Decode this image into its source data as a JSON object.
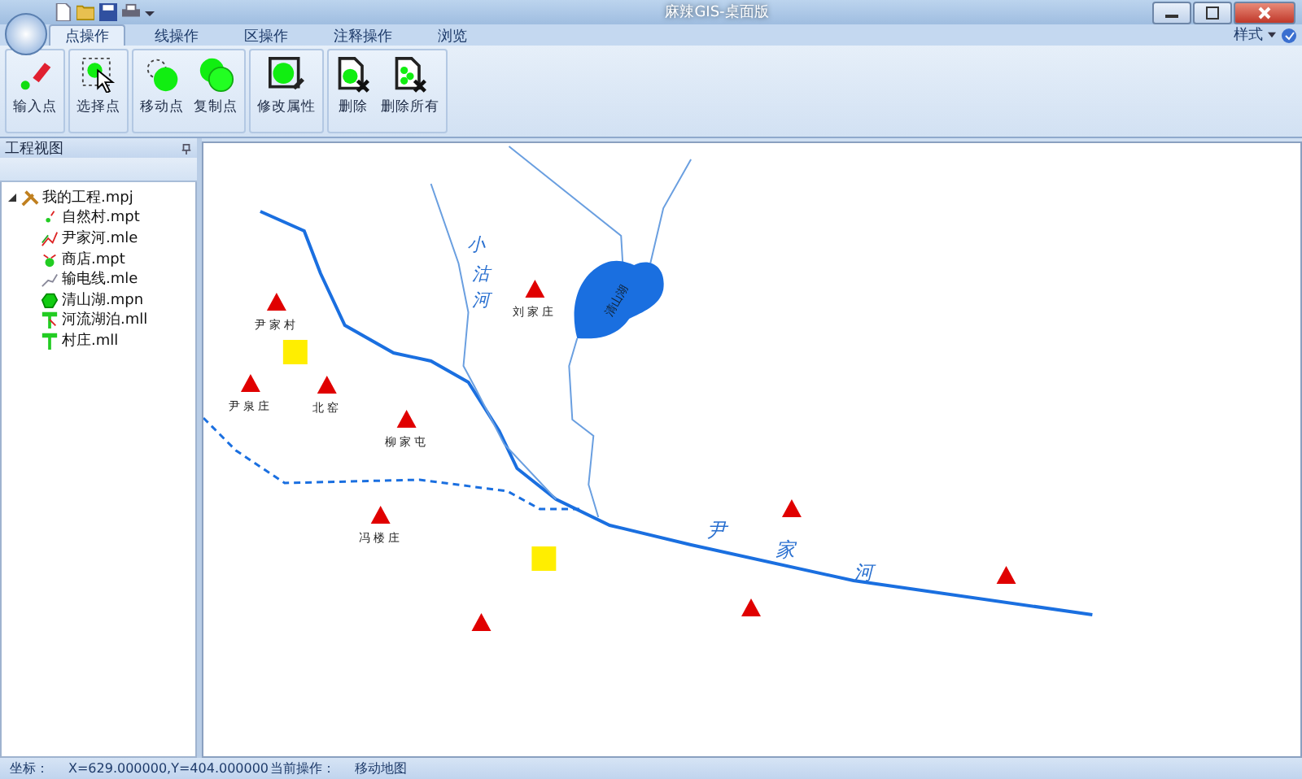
{
  "window": {
    "title": "麻辣GIS-桌面版"
  },
  "tabs": [
    {
      "label": "点操作",
      "selected": true
    },
    {
      "label": "线操作",
      "selected": false
    },
    {
      "label": "区操作",
      "selected": false
    },
    {
      "label": "注释操作",
      "selected": false
    },
    {
      "label": "浏览",
      "selected": false
    }
  ],
  "style_menu": "样式",
  "ribbon_groups": [
    {
      "buttons": [
        {
          "label": "输入点",
          "kind": "input"
        }
      ]
    },
    {
      "buttons": [
        {
          "label": "选择点",
          "kind": "select"
        }
      ]
    },
    {
      "buttons": [
        {
          "label": "移动点",
          "kind": "move"
        },
        {
          "label": "复制点",
          "kind": "copy"
        }
      ]
    },
    {
      "buttons": [
        {
          "label": "修改属性",
          "kind": "edit"
        }
      ]
    },
    {
      "buttons": [
        {
          "label": "删除",
          "kind": "delete"
        },
        {
          "label": "删除所有",
          "kind": "deleteall"
        }
      ]
    }
  ],
  "sidebar": {
    "title": "工程视图",
    "tree": [
      {
        "label": "我的工程.mpj",
        "kind": "project",
        "expanded": true,
        "children": [
          {
            "label": "自然村.mpt",
            "kind": "point"
          },
          {
            "label": "尹家河.mle",
            "kind": "line"
          },
          {
            "label": "商店.mpt",
            "kind": "point2"
          },
          {
            "label": "输电线.mle",
            "kind": "line2"
          },
          {
            "label": "清山湖.mpn",
            "kind": "area"
          },
          {
            "label": "河流湖泊.mll",
            "kind": "layer2"
          },
          {
            "label": "村庄.mll",
            "kind": "layer"
          }
        ]
      }
    ]
  },
  "map": {
    "places": [
      "尹家村",
      "尹泉庄",
      "北窑",
      "柳家屯",
      "刘家庄",
      "冯楼庄"
    ],
    "rivers": [
      "小沽河",
      "尹家河"
    ],
    "lake": "清山湖"
  },
  "status_bar": {
    "coord_label": "坐标：",
    "coord_value": "X=629.000000,Y=404.000000",
    "op_label": "当前操作：",
    "op_value": "移动地图"
  }
}
